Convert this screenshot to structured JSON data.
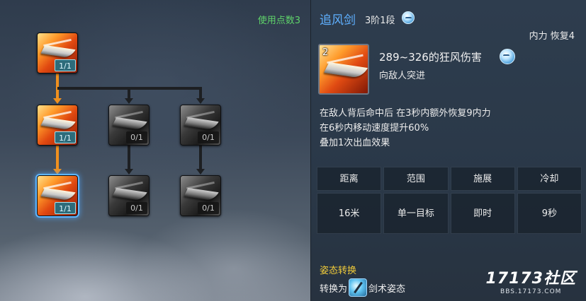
{
  "tree": {
    "points_used": "使用点数3",
    "nodes": [
      {
        "rank": "1/1",
        "state": "active"
      },
      {
        "rank": "1/1",
        "state": "active"
      },
      {
        "rank": "0/1",
        "state": "locked"
      },
      {
        "rank": "0/1",
        "state": "locked"
      },
      {
        "rank": "1/1",
        "state": "active-selected"
      },
      {
        "rank": "0/1",
        "state": "locked"
      },
      {
        "rank": "0/1",
        "state": "locked"
      }
    ]
  },
  "detail": {
    "name": "追风剑",
    "tier": "3阶1段",
    "resource": "内力 恢复4",
    "icon_level": "2",
    "damage": "289~326的狂风伤害",
    "description": "向敌人突进",
    "effects": [
      "在敌人背后命中后 在3秒内额外恢复9内力",
      "在6秒内移动速度提升60%",
      "叠加1次出血效果"
    ],
    "stats": {
      "headers": [
        "距离",
        "范围",
        "施展",
        "冷却"
      ],
      "values": [
        "16米",
        "单一目标",
        "即时",
        "9秒"
      ]
    },
    "stance_title": "姿态转换",
    "stance_prefix": "转换为",
    "stance_name": "剑术姿态"
  },
  "watermark": {
    "logo": "17173社区",
    "url": "BBS.17173.COM"
  },
  "colors": {
    "name_blue": "#5fb0ff",
    "points_green": "#5fd36a",
    "stance_gold": "#f2cc3a",
    "path_orange": "#f0901e"
  }
}
